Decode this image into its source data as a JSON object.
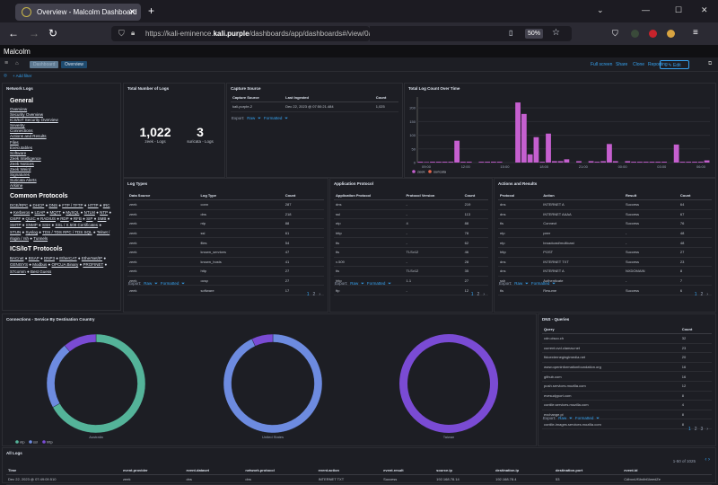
{
  "browser": {
    "tab_title": "Overview - Malcolm Dashboard",
    "url_pre": "https://kali-eminence.",
    "url_host": "kali.purple",
    "url_post": "/dashboards/app/dashboards#/view/0ad3d7c2-3441-485e-9dfe-dbb22e84e5",
    "zoom": "50%"
  },
  "app": {
    "logo": "Malcolm",
    "breadcrumb": [
      "Dashboard",
      "Overview"
    ],
    "actions": [
      "Full screen",
      "Share",
      "Clone",
      "Reporting"
    ],
    "edit": "Edit",
    "add_filter": "+ Add filter"
  },
  "sidebar": {
    "title": "Network Logs",
    "general_heading": "General",
    "general": [
      "Overview",
      "Security Overview",
      "ICS/IoT Security Overview",
      "Severity",
      "Connections",
      "Actions and Results",
      "Files",
      "Executables",
      "Software",
      "Zeek Intelligence",
      "Zeek Notices",
      "Zeek Weird",
      "Signatures",
      "Suricata Alerts",
      "Arkime"
    ],
    "common_heading": "Common Protocols",
    "common": [
      "DCE/RPC",
      "DHCP",
      "DNS",
      "FTP / TFTP",
      "HTTP",
      "IRC",
      "Kerberos",
      "LDAP",
      "MQTT",
      "MySQL",
      "NTLM",
      "NTP",
      "OSPF",
      "QUIC",
      "RADIUS",
      "RDP",
      "RFB",
      "SIP",
      "SMB",
      "SMTP",
      "SNMP",
      "SSH",
      "SSL / X.509 Certificates",
      "STUN",
      "Syslog",
      "TDS / TDS RPC / TDS SQL",
      "Telnet / rlogin / rsh",
      "Tunnels"
    ],
    "ics_heading": "ICS/IoT Protocols",
    "ics": [
      "BACnet",
      "BSAP",
      "DNP3",
      "EtherCAT",
      "EtherNet/IP",
      "GENISYS",
      "Modbus",
      "OPCUA Binary",
      "PROFINET",
      "S7comm",
      "Best Guess"
    ]
  },
  "total_logs": {
    "title": "Total Number of Logs",
    "items": [
      {
        "value": "1,022",
        "label": "zeek - Logs"
      },
      {
        "value": "3",
        "label": "suricata - Logs"
      }
    ]
  },
  "capture": {
    "title": "Capture Source",
    "headers": [
      "Capture Source",
      "Last Ingested",
      "Count"
    ],
    "rows": [
      [
        "kali-purple-2",
        "Dec 22, 2023 @ 07:50:21.484",
        "1,025"
      ]
    ]
  },
  "export": {
    "label": "Export:",
    "raw": "Raw",
    "formatted": "Formatted"
  },
  "histogram": {
    "title": "Total Log Count Over Time"
  },
  "chart_data": {
    "type": "bar",
    "title": "Total Log Count Over Time",
    "ylim": [
      0,
      240
    ],
    "yticks": [
      0,
      50,
      100,
      150,
      200
    ],
    "xticks": [
      "09:00",
      "12:00",
      "15:00",
      "18:00",
      "21:00",
      "00:00",
      "03:00",
      "06:00"
    ],
    "series": [
      {
        "name": "zeek",
        "color": "#c55fcf",
        "values": [
          3,
          2,
          3,
          3,
          3,
          3,
          80,
          3,
          3,
          0,
          3,
          3,
          3,
          3,
          0,
          0,
          220,
          178,
          30,
          93,
          3,
          106,
          5,
          5,
          12,
          0,
          5,
          0,
          5,
          3,
          5,
          68,
          5,
          0,
          5,
          3,
          3,
          3,
          3,
          3,
          3,
          0,
          66,
          3,
          3,
          3,
          3,
          8
        ]
      },
      {
        "name": "suricata",
        "color": "#e7664c",
        "values": []
      }
    ]
  },
  "log_types": {
    "title": "Log Types",
    "headers": [
      "Data Source",
      "Log Type",
      "Count"
    ],
    "rows": [
      [
        "zeek",
        "conn",
        "287"
      ],
      [
        "zeek",
        "dns",
        "218"
      ],
      [
        "zeek",
        "ntp",
        "88"
      ],
      [
        "zeek",
        "ssl",
        "61"
      ],
      [
        "zeek",
        "files",
        "54"
      ],
      [
        "zeek",
        "known_services",
        "47"
      ],
      [
        "zeek",
        "known_hosts",
        "41"
      ],
      [
        "zeek",
        "http",
        "27"
      ],
      [
        "zeek",
        "ocsp",
        "27"
      ],
      [
        "zeek",
        "software",
        "17"
      ]
    ],
    "pages": [
      "1",
      "2"
    ]
  },
  "app_protocol": {
    "title": "Application Protocol",
    "headers": [
      "Application Protocol",
      "Protocol Version",
      "Count"
    ],
    "rows": [
      [
        "dns",
        "-",
        "219"
      ],
      [
        "ssl",
        "-",
        "113"
      ],
      [
        "ntp",
        "4",
        "88"
      ],
      [
        "http",
        "-",
        "78"
      ],
      [
        "tls",
        "-",
        "62"
      ],
      [
        "tls",
        "TLSv12",
        "46"
      ],
      [
        "x.509",
        "-",
        "28"
      ],
      [
        "tls",
        "TLSv12",
        "35"
      ],
      [
        "http",
        "1.1",
        "27"
      ],
      [
        "ftp",
        "-",
        "12"
      ]
    ],
    "pages": [
      "1",
      "2"
    ]
  },
  "actions": {
    "title": "Actions and Results",
    "headers": [
      "Protocol",
      "Action",
      "Result",
      "Count"
    ],
    "rows": [
      [
        "dns",
        "INTERNET A",
        "Success",
        "64"
      ],
      [
        "dns",
        "INTERNET AAAA",
        "Success",
        "67"
      ],
      [
        "tls",
        "Connect",
        "Success",
        "76"
      ],
      [
        "ntp",
        "peer",
        "-",
        "48"
      ],
      [
        "ntp",
        "broadcast/multicast",
        "-",
        "48"
      ],
      [
        "http",
        "POST",
        "Success",
        "27"
      ],
      [
        "dns",
        "INTERNET TXT",
        "Success",
        "23"
      ],
      [
        "dns",
        "INTERNET A",
        "NXDOMAIN",
        "8"
      ],
      [
        "ssh",
        "Authenticate",
        "-",
        "7"
      ],
      [
        "tls",
        "Resume",
        "Success",
        "6"
      ]
    ],
    "pages": [
      "1",
      "2"
    ]
  },
  "donuts": {
    "title": "Connections - Service By Destination Country",
    "legend": [
      {
        "name": "ntp",
        "color": "#54b399"
      },
      {
        "name": "ssl",
        "color": "#6d8be0"
      },
      {
        "name": "http",
        "color": "#7a4bd4"
      }
    ],
    "charts": [
      {
        "label": "Australia",
        "slices": [
          {
            "name": "ntp",
            "value": 67
          },
          {
            "name": "ssl",
            "value": 22
          },
          {
            "name": "http",
            "value": 11
          }
        ]
      },
      {
        "label": "United States",
        "slices": [
          {
            "name": "ssl",
            "value": 93
          },
          {
            "name": "http",
            "value": 7
          }
        ]
      },
      {
        "label": "Taiwan",
        "slices": [
          {
            "name": "http",
            "value": 100
          }
        ]
      }
    ]
  },
  "dns": {
    "title": "DNS - Queries",
    "headers": [
      "Query",
      "Count"
    ],
    "rows": [
      [
        "cdn.cisco.ch",
        "32"
      ],
      [
        "current.cvd.clamav.net",
        "23"
      ],
      [
        "fidoexternegingtmedia.net",
        "20"
      ],
      [
        "www.openinformationfoundation.org",
        "16"
      ],
      [
        "github.com",
        "16"
      ],
      [
        "push.services.mozilla.com",
        "12"
      ],
      [
        "evesudyport.com",
        "8"
      ],
      [
        "contile.services.mozilla.com",
        "4"
      ],
      [
        "exchange.pi",
        "8"
      ],
      [
        "contile-images.services.mozilla.com",
        "8"
      ]
    ],
    "pages": [
      "1",
      "2",
      "3"
    ]
  },
  "all_logs": {
    "title": "All Logs",
    "range": "1-50 of 1025",
    "headers": [
      "Time",
      "event.provider",
      "event.dataset",
      "network.protocol",
      "event.action",
      "event.result",
      "source.ip",
      "destination.ip",
      "destination.port",
      "event.id"
    ],
    "row": [
      "Dec 22, 2023 @ 07:49:09.510",
      "zeek",
      "dns",
      "dns",
      "INTERNET TXT",
      "Success",
      "192.168.78.14",
      "192.168.78.4",
      "53",
      "CdboxUf1bdbt1lwedZe"
    ]
  }
}
